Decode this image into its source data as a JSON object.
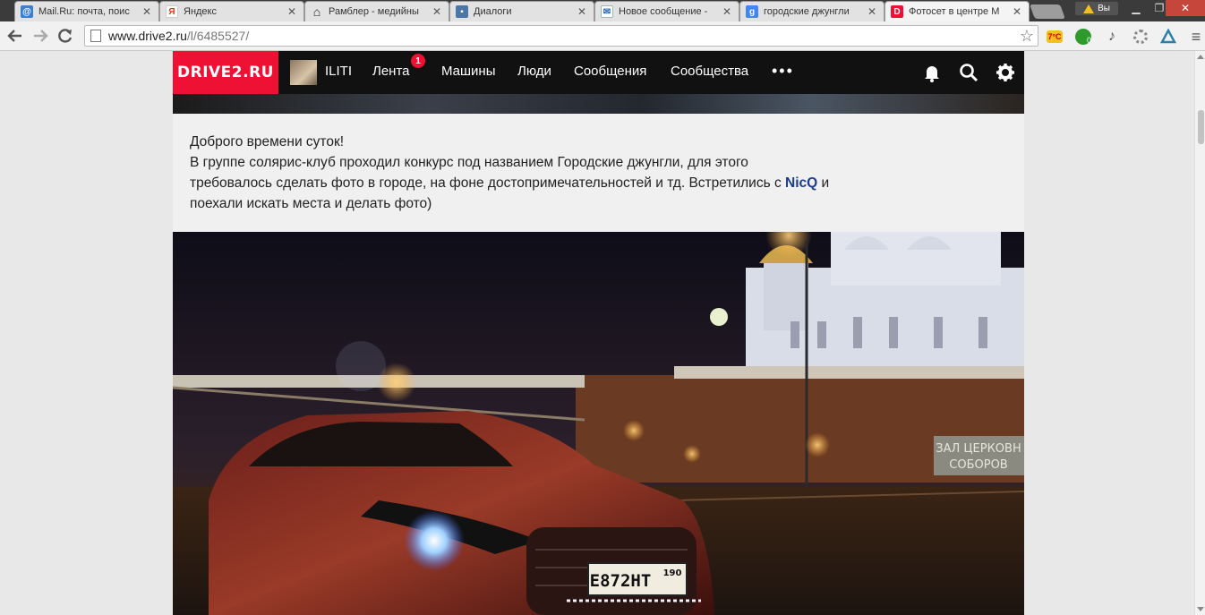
{
  "browser": {
    "tabs": [
      {
        "title": "Mail.Ru: почта, поис",
        "icon": "mailru-icon",
        "color": "#3a7fd6",
        "glyph": "@"
      },
      {
        "title": "Яндекс",
        "icon": "yandex-icon",
        "color": "#ffffff",
        "glyph": "Я"
      },
      {
        "title": "Рамблер - медийны",
        "icon": "home-icon",
        "color": "#444444",
        "glyph": "⌂"
      },
      {
        "title": "Диалоги",
        "icon": "chat-icon",
        "color": "#4a76a8",
        "glyph": "▪"
      },
      {
        "title": "Новое сообщение -",
        "icon": "mail-icon",
        "color": "#1c5db5",
        "glyph": "✉"
      },
      {
        "title": "городские джунгли",
        "icon": "google-icon",
        "color": "#4285f4",
        "glyph": "g"
      },
      {
        "title": "Фотосет в центре М",
        "icon": "drive2-icon",
        "color": "#ee1133",
        "glyph": "D"
      }
    ],
    "user_label": "Вы",
    "url_host": "www.drive2.ru",
    "url_path": "/l/6485527/",
    "weather_badge": "7°C",
    "ext_count": "0"
  },
  "site": {
    "logo": "DRIVE2.RU",
    "username": "ILITI",
    "nav": [
      "Лента",
      "Машины",
      "Люди",
      "Сообщения",
      "Сообщества"
    ],
    "feed_badge": "1",
    "more": "•••"
  },
  "post": {
    "line1": "Доброго времени суток!",
    "line2": "В группе солярис-клуб проходил конкурс под названием Городские джунгли, для этого",
    "line3_before": "требовалось сделать фото в городе, на фоне достопримечательностей и тд. Встретились с ",
    "mention": "NicQ",
    "line3_after": " и",
    "line4": "поехали искать места и делать фото)"
  },
  "photo": {
    "plate": "Е872НТ",
    "region": "190",
    "sign_line1": "ЗАЛ ЦЕРКОВН",
    "sign_line2": "СОБОРОВ"
  }
}
